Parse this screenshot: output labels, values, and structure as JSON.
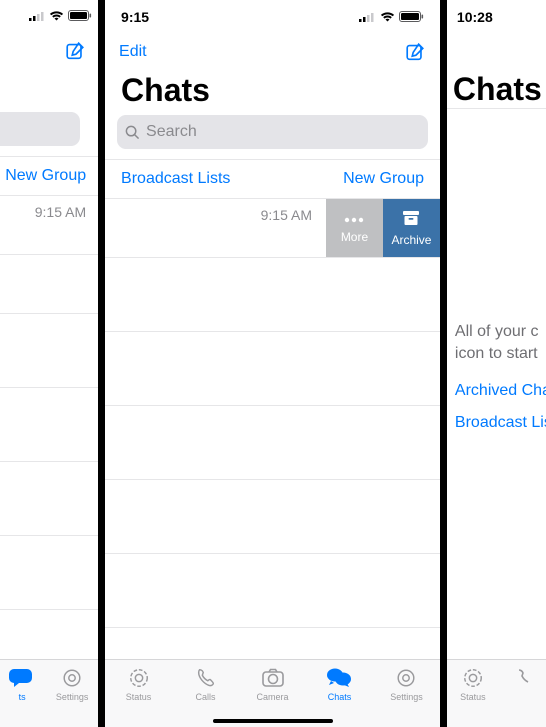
{
  "phones": {
    "left": {
      "newGroup": "New Group",
      "chatTime": "9:15 AM",
      "tabs": {
        "chats": "ts",
        "settings": "Settings"
      }
    },
    "mid": {
      "time": "9:15",
      "edit": "Edit",
      "title": "Chats",
      "searchPlaceholder": "Search",
      "broadcast": "Broadcast Lists",
      "newGroup": "New Group",
      "chatTime": "9:15 AM",
      "swipe": {
        "more": "More",
        "archive": "Archive"
      },
      "tabs": {
        "status": "Status",
        "calls": "Calls",
        "camera": "Camera",
        "chats": "Chats",
        "settings": "Settings"
      }
    },
    "right": {
      "time": "10:28",
      "title": "Chats",
      "infoLine1": "All of your c",
      "infoLine2": "icon to start",
      "archived": "Archived Cha",
      "broadcast": "Broadcast Lis",
      "tabs": {
        "status": "Status"
      }
    }
  },
  "colors": {
    "accent": "#007aff"
  }
}
